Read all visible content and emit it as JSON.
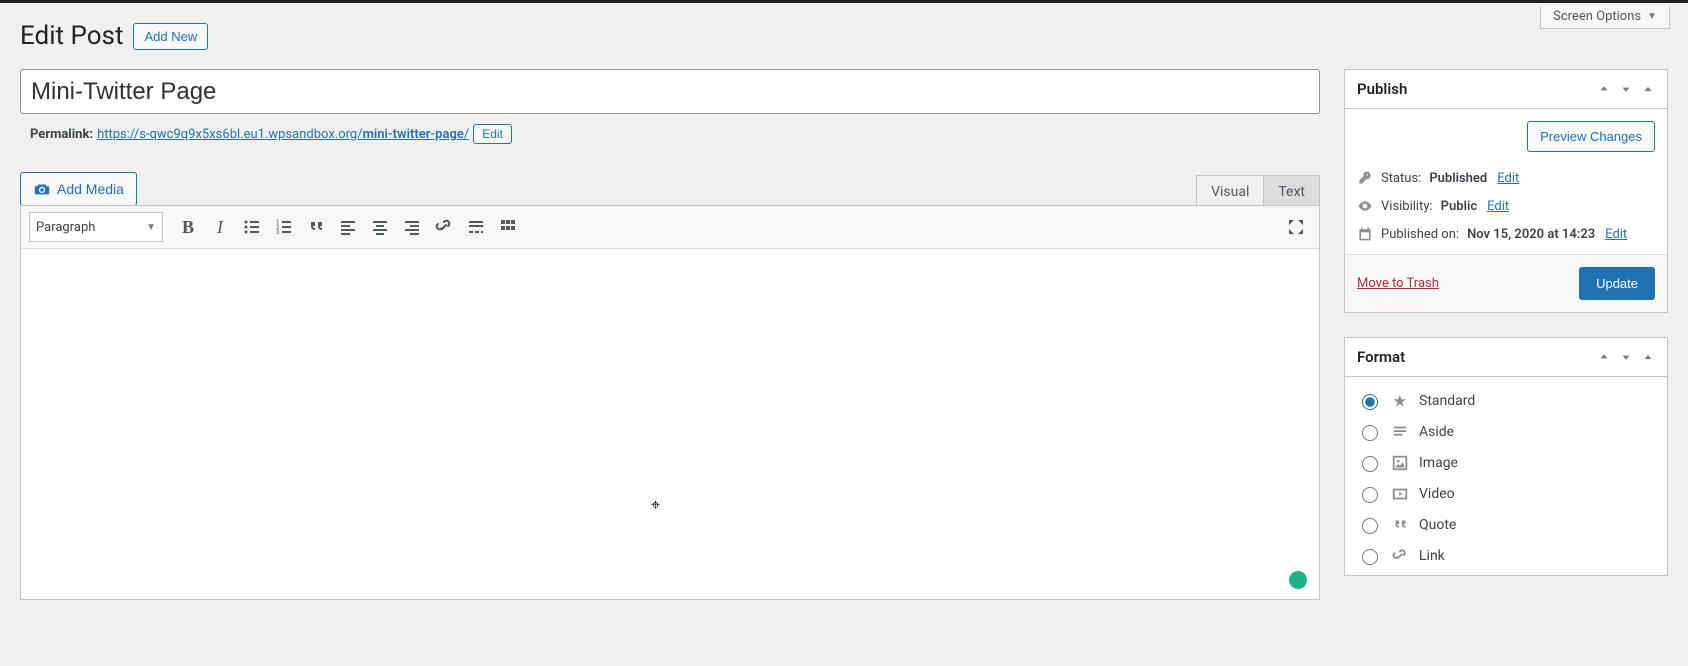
{
  "screen_options_label": "Screen Options",
  "page_heading": "Edit Post",
  "add_new_label": "Add New",
  "post_title": "Mini-Twitter Page",
  "permalink": {
    "label": "Permalink:",
    "base": "https://s-qwc9q9x5xs6bl.eu1.wpsandbox.org/",
    "slug": "mini-twitter-page",
    "trailing": "/",
    "edit_label": "Edit"
  },
  "add_media_label": "Add Media",
  "editor_tabs": {
    "visual": "Visual",
    "text": "Text"
  },
  "format_dropdown": "Paragraph",
  "publish": {
    "title": "Publish",
    "preview_label": "Preview Changes",
    "status_label": "Status:",
    "status_value": "Published",
    "status_edit": "Edit",
    "visibility_label": "Visibility:",
    "visibility_value": "Public",
    "visibility_edit": "Edit",
    "published_label": "Published on:",
    "published_value": "Nov 15, 2020 at 14:23",
    "published_edit": "Edit",
    "trash_label": "Move to Trash",
    "update_label": "Update"
  },
  "format_box": {
    "title": "Format",
    "options": [
      {
        "key": "standard",
        "label": "Standard",
        "checked": true
      },
      {
        "key": "aside",
        "label": "Aside",
        "checked": false
      },
      {
        "key": "image",
        "label": "Image",
        "checked": false
      },
      {
        "key": "video",
        "label": "Video",
        "checked": false
      },
      {
        "key": "quote",
        "label": "Quote",
        "checked": false
      },
      {
        "key": "link",
        "label": "Link",
        "checked": false
      }
    ]
  }
}
